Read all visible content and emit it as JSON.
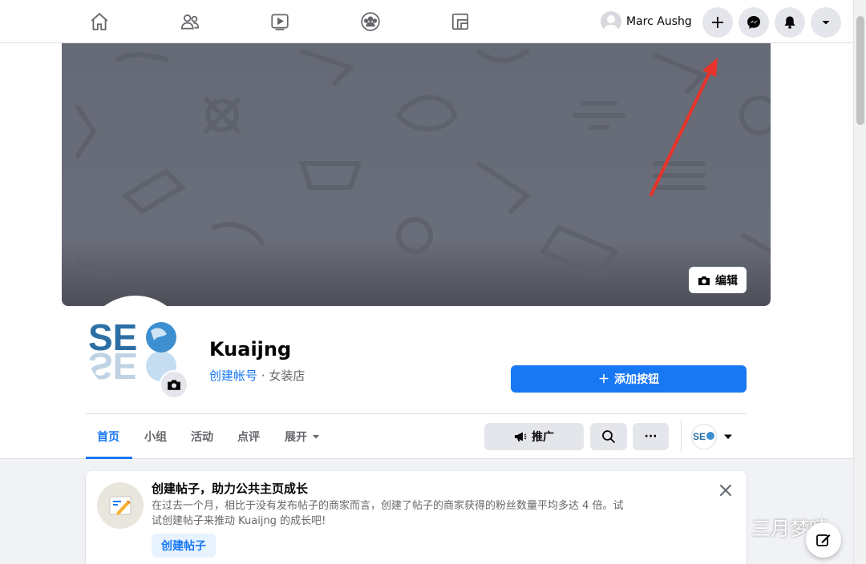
{
  "topbar": {
    "nav_icons": [
      "home-icon",
      "friends-icon",
      "watch-icon",
      "groups-icon",
      "pages-icon"
    ],
    "profile_name": "Marc Aushg",
    "actions": [
      "plus-icon",
      "messenger-icon",
      "bell-icon",
      "caret-down-icon"
    ]
  },
  "cover": {
    "edit_label": "编辑"
  },
  "page": {
    "name": "Kuaijng",
    "create_account_link": "创建帐号",
    "separator": " · ",
    "category": "女装店",
    "add_button_label": "添加按钮"
  },
  "tabs": [
    {
      "label": "首页",
      "active": true
    },
    {
      "label": "小组",
      "active": false
    },
    {
      "label": "活动",
      "active": false
    },
    {
      "label": "点评",
      "active": false
    },
    {
      "label": "展开",
      "active": false
    }
  ],
  "action_buttons": {
    "promote_label": "推广",
    "more_label": "···"
  },
  "post_card": {
    "title": "创建帖子，助力公共主页成长",
    "body": "在过去一个月，相比于没有发布帖子的商家而言，创建了帖子的商家获得的粉丝数量平均多达 4 倍。试试创建帖子来推动 Kuaijng 的成长吧!",
    "cta_label": "创建帖子"
  },
  "watermark": {
    "text": "三月梦唛"
  },
  "colors": {
    "accent": "#1877f2",
    "cover": "#666a76",
    "annotation_arrow": "#e8332a"
  }
}
